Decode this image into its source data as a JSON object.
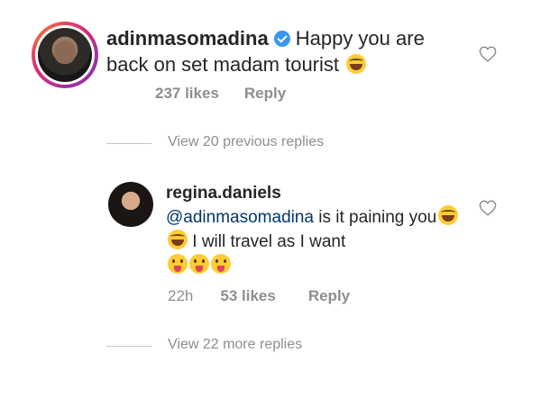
{
  "comment": {
    "username": "adinmasomadina",
    "text": "Happy you are back on set madam tourist",
    "likes": "237 likes",
    "reply_label": "Reply"
  },
  "view_previous": "View 20 previous replies",
  "reply": {
    "username": "regina.daniels",
    "mention": "@adinmasomadina",
    "text_part1": " is it paining you",
    "text_part2": " I will travel as I want",
    "time": "22h",
    "likes": "53 likes",
    "reply_label": "Reply"
  },
  "view_more": "View 22 more replies",
  "colors": {
    "verified": "#3897f0",
    "meta_text": "#8e8e8e",
    "mention": "#00376b"
  }
}
